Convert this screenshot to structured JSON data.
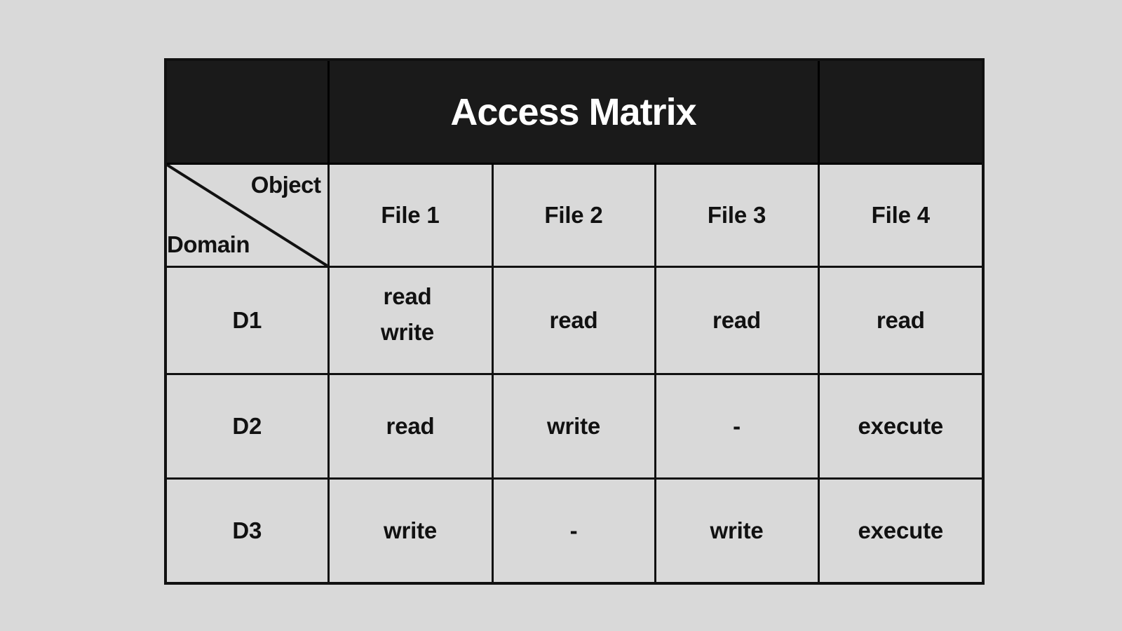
{
  "page": {
    "background_color": "#d9d9d9",
    "header_color": "#1a1a1a",
    "border_color": "#111111",
    "title_text_color": "#ffffff",
    "body_text_color": "#111111"
  },
  "title": "Access Matrix",
  "corner": {
    "column_axis_label": "Object",
    "row_axis_label": "Domain"
  },
  "columns": [
    "File 1",
    "File 2",
    "File 3",
    "File 4"
  ],
  "rows": [
    {
      "domain": "D1",
      "cells": [
        {
          "lines": [
            "read",
            "write"
          ]
        },
        {
          "lines": [
            "read"
          ]
        },
        {
          "lines": [
            "read"
          ]
        },
        {
          "lines": [
            "read"
          ]
        }
      ]
    },
    {
      "domain": "D2",
      "cells": [
        {
          "lines": [
            "read"
          ]
        },
        {
          "lines": [
            "write"
          ]
        },
        {
          "lines": [
            "-"
          ]
        },
        {
          "lines": [
            "execute"
          ]
        }
      ]
    },
    {
      "domain": "D3",
      "cells": [
        {
          "lines": [
            "write"
          ]
        },
        {
          "lines": [
            "-"
          ]
        },
        {
          "lines": [
            "write"
          ]
        },
        {
          "lines": [
            "execute"
          ]
        }
      ]
    }
  ]
}
